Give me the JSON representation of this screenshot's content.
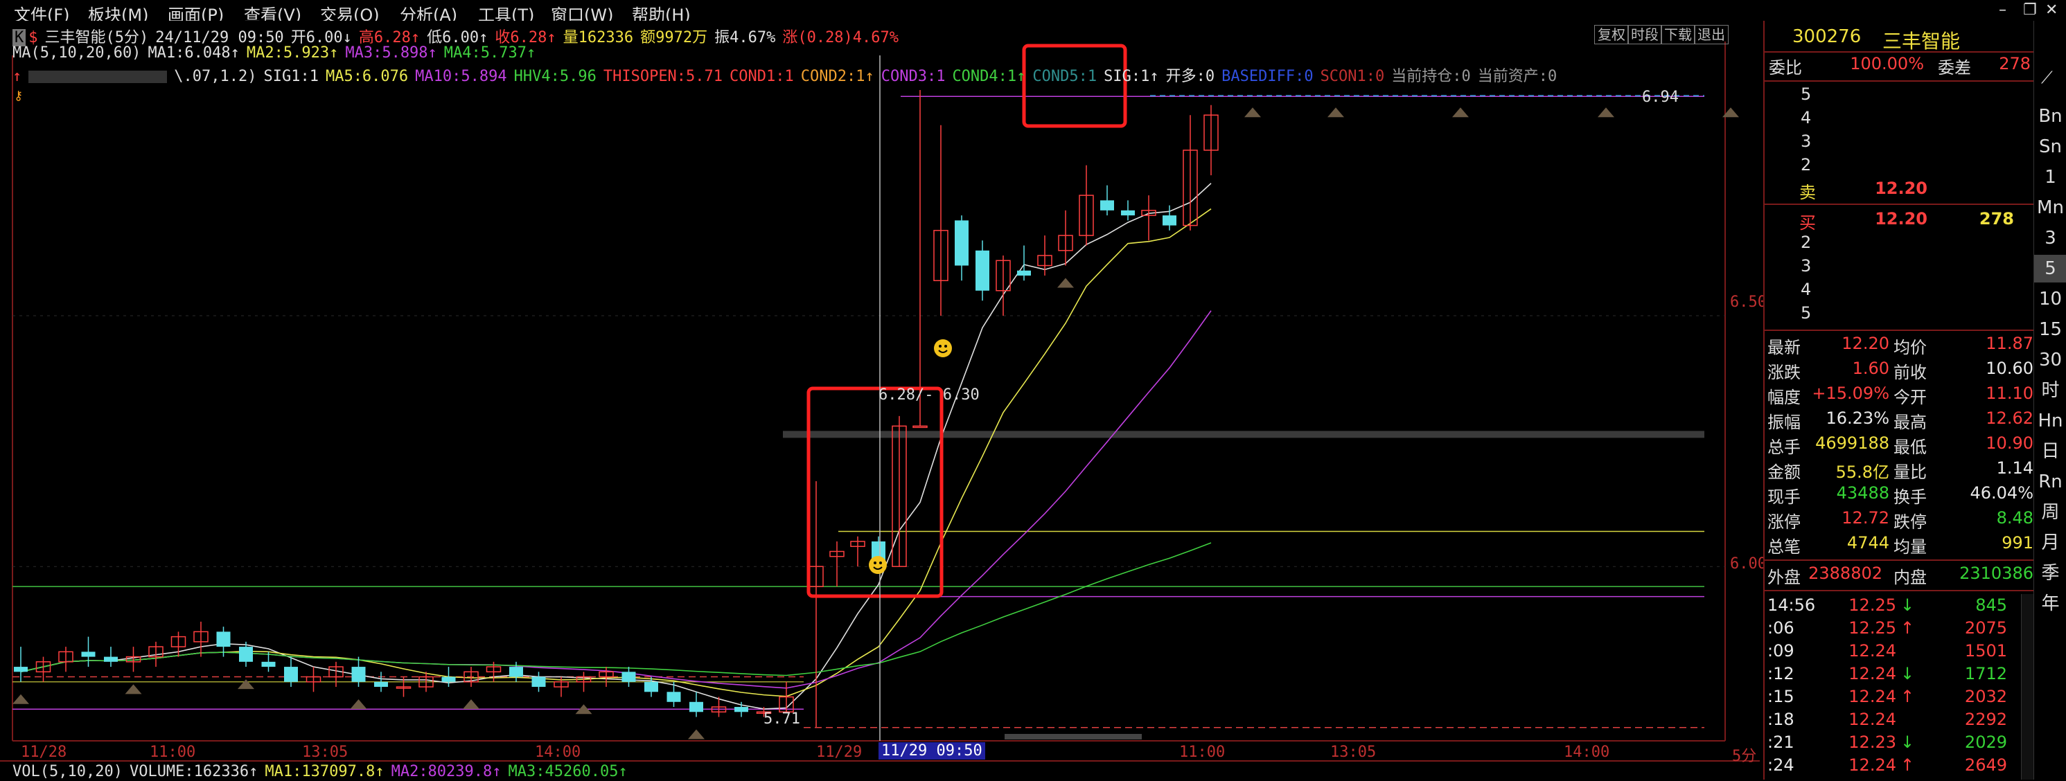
{
  "menu": [
    "文件(F)",
    "板块(M)",
    "画面(P)",
    "查看(V)",
    "交易(O)",
    "分析(A)",
    "工具(T)",
    "窗口(W)",
    "帮助(H)"
  ],
  "window_controls": [
    "–",
    "❐",
    "✕"
  ],
  "header": {
    "k_badge": "K",
    "dollar": "$",
    "title": "三丰智能(5分)",
    "date_time": "24/11/29 09:50",
    "open": "开6.00↓",
    "high": "高6.28↑",
    "low": "低6.00↑",
    "close": "收6.28↑",
    "volume": "量162336",
    "amount": "额9972万",
    "amplitude": "振4.67%",
    "change": "涨(0.28)4.67%"
  },
  "top_tabs": [
    "复权",
    "时段",
    "下载",
    "退出"
  ],
  "ma_line": {
    "prefix": "MA(5,10,20,60)",
    "ma1": "MA1:6.048↑",
    "ma2": "MA2:5.923↑",
    "ma3": "MA3:5.898↑",
    "ma4": "MA4:5.737↑"
  },
  "indicator_line": {
    "prefix": "\\.07,1.2)",
    "sig1": "SIG1:1",
    "ma5": "MA5:6.076",
    "ma10": "MA10:5.894",
    "hhv4": "HHV4:5.96",
    "thisopen": "THISOPEN:5.71",
    "cond1": "COND1:1",
    "cond2": "COND2:1↑",
    "cond3": "COND3:1",
    "cond4": "COND4:1↑",
    "cond5": "COND5:1",
    "sig": "SIG:1↑",
    "kaiduo": "开多:0",
    "basediff": "BASEDIFF:0",
    "scon1": "SCON1:0",
    "holding": "当前持仓:0",
    "assets": "当前资产:0"
  },
  "price_labels": {
    "p650": "6.50",
    "p600": "6.00",
    "max_label": "6.94",
    "min_label": "5.71",
    "crosshair_label": "6.28/- 6.30"
  },
  "x_axis": {
    "labels": [
      "11/28",
      "11:00",
      "13:05",
      "14:00",
      "11/29",
      "11/29 09:50",
      "11:00",
      "13:05",
      "14:00"
    ],
    "period": "5分"
  },
  "volume_line": {
    "prefix": "VOL(5,10,20)",
    "volume": "VOLUME:162336↑",
    "ma1": "MA1:137097.8↑",
    "ma2": "MA2:80239.8↑",
    "ma3": "MA3:45260.05↑"
  },
  "colors": {
    "up": "#ff4040",
    "down": "#5ee0e8",
    "ma1": "#e0e0e0",
    "ma2": "#e8e850",
    "ma3": "#c040e0",
    "ma4": "#40d040",
    "box": "#ff2020"
  },
  "stock": {
    "code": "300276",
    "name": "三丰智能"
  },
  "order_book": {
    "weibi_label": "委比",
    "weibi_value": "100.00%",
    "weicha_label": "委差",
    "weicha_value": "278",
    "sell_levels": [
      "5",
      "4",
      "3",
      "2"
    ],
    "sell1_label": "卖",
    "sell1_price": "12.20",
    "buy1_label": "买",
    "buy1_price": "12.20",
    "buy1_volume": "278",
    "buy_levels": [
      "2",
      "3",
      "4",
      "5"
    ]
  },
  "quote": [
    {
      "l1": "最新",
      "v1": "12.20",
      "c1": "red",
      "l2": "均价",
      "v2": "11.87",
      "c2": "red"
    },
    {
      "l1": "涨跌",
      "v1": "1.60",
      "c1": "red",
      "l2": "前收",
      "v2": "10.60",
      "c2": "white"
    },
    {
      "l1": "幅度",
      "v1": "+15.09%",
      "c1": "red",
      "l2": "今开",
      "v2": "11.10",
      "c2": "red"
    },
    {
      "l1": "振幅",
      "v1": "16.23%",
      "c1": "white",
      "l2": "最高",
      "v2": "12.62",
      "c2": "red"
    },
    {
      "l1": "总手",
      "v1": "4699188",
      "c1": "yellow",
      "l2": "最低",
      "v2": "10.90",
      "c2": "red"
    },
    {
      "l1": "金额",
      "v1": "55.8亿",
      "c1": "yellow",
      "l2": "量比",
      "v2": "1.14",
      "c2": "white"
    },
    {
      "l1": "现手",
      "v1": "43488",
      "c1": "green",
      "l2": "换手",
      "v2": "46.04%",
      "c2": "white"
    },
    {
      "l1": "涨停",
      "v1": "12.72",
      "c1": "red",
      "l2": "跌停",
      "v2": "8.48",
      "c2": "green"
    },
    {
      "l1": "总笔",
      "v1": "4744",
      "c1": "yellow",
      "l2": "均量",
      "v2": "991",
      "c2": "yellow"
    }
  ],
  "outer_inner": {
    "outer_label": "外盘",
    "outer_value": "2388802",
    "inner_label": "内盘",
    "inner_value": "2310386"
  },
  "ticks": [
    {
      "time": "14:56",
      "price": "12.25",
      "arrow": "↓",
      "vol": "845",
      "vc": "green"
    },
    {
      "time": ":06",
      "price": "12.25",
      "arrow": "↑",
      "vol": "2075",
      "vc": "red"
    },
    {
      "time": ":09",
      "price": "12.24",
      "arrow": "",
      "vol": "1501",
      "vc": "red"
    },
    {
      "time": ":12",
      "price": "12.24",
      "arrow": "↓",
      "vol": "1712",
      "vc": "green"
    },
    {
      "time": ":15",
      "price": "12.24",
      "arrow": "↑",
      "vol": "2032",
      "vc": "red"
    },
    {
      "time": ":18",
      "price": "12.24",
      "arrow": "",
      "vol": "2292",
      "vc": "red"
    },
    {
      "time": ":21",
      "price": "12.23",
      "arrow": "↓",
      "vol": "2029",
      "vc": "green"
    },
    {
      "time": ":24",
      "price": "12.24",
      "arrow": "↑",
      "vol": "2649",
      "vc": "red"
    }
  ],
  "periods": [
    "Bn",
    "Sn",
    "1",
    "Mn",
    "3",
    "5",
    "10",
    "15",
    "30",
    "时",
    "Hn",
    "日",
    "Rn",
    "周",
    "月",
    "季",
    "年"
  ],
  "active_period": "5",
  "chart_data": {
    "type": "candlestick",
    "title": "三丰智能(5分)",
    "xlabel": "",
    "ylabel": "",
    "ylim": [
      5.71,
      6.94
    ],
    "y_ticks": [
      6.0,
      6.5
    ],
    "x_ticks": [
      "11/28",
      "11:00",
      "13:05",
      "14:00",
      "11/29",
      "11/29 09:50",
      "11:00",
      "13:05",
      "14:00"
    ],
    "candles": [
      {
        "o": 5.8,
        "h": 5.84,
        "l": 5.77,
        "c": 5.79
      },
      {
        "o": 5.79,
        "h": 5.82,
        "l": 5.77,
        "c": 5.81
      },
      {
        "o": 5.81,
        "h": 5.84,
        "l": 5.79,
        "c": 5.83
      },
      {
        "o": 5.83,
        "h": 5.86,
        "l": 5.8,
        "c": 5.82
      },
      {
        "o": 5.82,
        "h": 5.84,
        "l": 5.8,
        "c": 5.81
      },
      {
        "o": 5.81,
        "h": 5.84,
        "l": 5.79,
        "c": 5.82
      },
      {
        "o": 5.82,
        "h": 5.85,
        "l": 5.8,
        "c": 5.84
      },
      {
        "o": 5.84,
        "h": 5.87,
        "l": 5.82,
        "c": 5.86
      },
      {
        "o": 5.85,
        "h": 5.89,
        "l": 5.82,
        "c": 5.87
      },
      {
        "o": 5.87,
        "h": 5.88,
        "l": 5.82,
        "c": 5.84
      },
      {
        "o": 5.84,
        "h": 5.85,
        "l": 5.8,
        "c": 5.81
      },
      {
        "o": 5.81,
        "h": 5.83,
        "l": 5.79,
        "c": 5.8
      },
      {
        "o": 5.8,
        "h": 5.82,
        "l": 5.76,
        "c": 5.77
      },
      {
        "o": 5.77,
        "h": 5.8,
        "l": 5.75,
        "c": 5.78
      },
      {
        "o": 5.78,
        "h": 5.81,
        "l": 5.76,
        "c": 5.8
      },
      {
        "o": 5.8,
        "h": 5.82,
        "l": 5.76,
        "c": 5.77
      },
      {
        "o": 5.77,
        "h": 5.79,
        "l": 5.75,
        "c": 5.76
      },
      {
        "o": 5.76,
        "h": 5.78,
        "l": 5.74,
        "c": 5.76
      },
      {
        "o": 5.76,
        "h": 5.79,
        "l": 5.75,
        "c": 5.78
      },
      {
        "o": 5.78,
        "h": 5.8,
        "l": 5.76,
        "c": 5.77
      },
      {
        "o": 5.77,
        "h": 5.8,
        "l": 5.76,
        "c": 5.79
      },
      {
        "o": 5.79,
        "h": 5.81,
        "l": 5.77,
        "c": 5.8
      },
      {
        "o": 5.8,
        "h": 5.81,
        "l": 5.77,
        "c": 5.78
      },
      {
        "o": 5.78,
        "h": 5.79,
        "l": 5.75,
        "c": 5.76
      },
      {
        "o": 5.76,
        "h": 5.78,
        "l": 5.74,
        "c": 5.77
      },
      {
        "o": 5.77,
        "h": 5.79,
        "l": 5.75,
        "c": 5.78
      },
      {
        "o": 5.78,
        "h": 5.8,
        "l": 5.76,
        "c": 5.79
      },
      {
        "o": 5.79,
        "h": 5.8,
        "l": 5.76,
        "c": 5.77
      },
      {
        "o": 5.77,
        "h": 5.78,
        "l": 5.74,
        "c": 5.75
      },
      {
        "o": 5.75,
        "h": 5.77,
        "l": 5.72,
        "c": 5.73
      },
      {
        "o": 5.73,
        "h": 5.75,
        "l": 5.7,
        "c": 5.71
      },
      {
        "o": 5.71,
        "h": 5.74,
        "l": 5.7,
        "c": 5.72
      },
      {
        "o": 5.72,
        "h": 5.73,
        "l": 5.7,
        "c": 5.71
      },
      {
        "o": 5.71,
        "h": 5.72,
        "l": 5.7,
        "c": 5.71
      },
      {
        "o": 5.71,
        "h": 5.77,
        "l": 5.71,
        "c": 5.74
      },
      {
        "o": 5.96,
        "h": 6.17,
        "l": 5.68,
        "c": 6.0
      },
      {
        "o": 6.02,
        "h": 6.05,
        "l": 5.96,
        "c": 6.03
      },
      {
        "o": 6.04,
        "h": 6.06,
        "l": 6.0,
        "c": 6.05
      },
      {
        "o": 6.05,
        "h": 6.06,
        "l": 5.99,
        "c": 6.0
      },
      {
        "o": 6.0,
        "h": 6.3,
        "l": 6.0,
        "c": 6.28
      },
      {
        "o": 6.28,
        "h": 6.95,
        "l": 6.28,
        "c": 6.28
      },
      {
        "o": 6.57,
        "h": 6.88,
        "l": 6.5,
        "c": 6.67
      },
      {
        "o": 6.69,
        "h": 6.7,
        "l": 6.57,
        "c": 6.6
      },
      {
        "o": 6.63,
        "h": 6.65,
        "l": 6.53,
        "c": 6.55
      },
      {
        "o": 6.55,
        "h": 6.62,
        "l": 6.5,
        "c": 6.61
      },
      {
        "o": 6.59,
        "h": 6.64,
        "l": 6.57,
        "c": 6.58
      },
      {
        "o": 6.6,
        "h": 6.66,
        "l": 6.58,
        "c": 6.62
      },
      {
        "o": 6.63,
        "h": 6.71,
        "l": 6.6,
        "c": 6.66
      },
      {
        "o": 6.66,
        "h": 6.8,
        "l": 6.64,
        "c": 6.74
      },
      {
        "o": 6.73,
        "h": 6.76,
        "l": 6.7,
        "c": 6.71
      },
      {
        "o": 6.71,
        "h": 6.73,
        "l": 6.69,
        "c": 6.7
      },
      {
        "o": 6.7,
        "h": 6.74,
        "l": 6.65,
        "c": 6.71
      },
      {
        "o": 6.7,
        "h": 6.72,
        "l": 6.67,
        "c": 6.68
      },
      {
        "o": 6.68,
        "h": 6.9,
        "l": 6.67,
        "c": 6.83
      },
      {
        "o": 6.83,
        "h": 6.92,
        "l": 6.78,
        "c": 6.9
      }
    ],
    "signals_up": [
      0,
      5,
      10,
      15,
      20,
      25,
      30,
      47,
      56,
      60,
      66,
      73,
      79
    ],
    "annotations": [
      "6.94",
      "5.71",
      "6.28/- 6.30"
    ]
  }
}
